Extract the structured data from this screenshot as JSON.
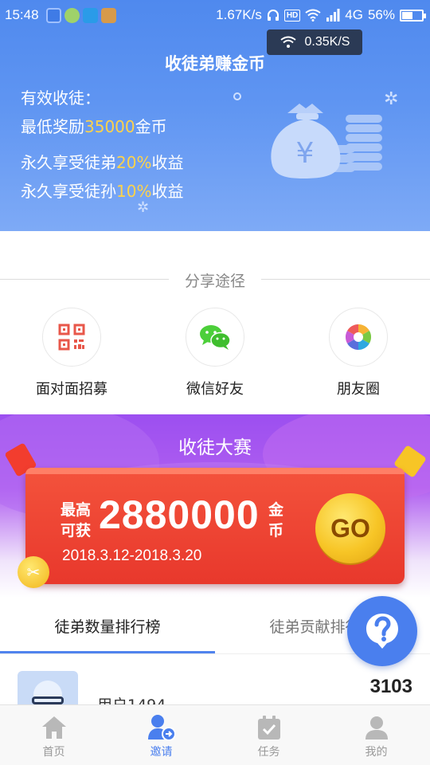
{
  "status_bar": {
    "time": "15:48",
    "network_speed": "1.67K/s",
    "hd_badge": "HD",
    "signal_type": "4G",
    "battery_percent": "56%",
    "battery_level": 0.56
  },
  "speed_popup": {
    "text": "0.35K/S"
  },
  "hero": {
    "title": "收徒弟赚金币",
    "line1": "有效收徒：",
    "line2_prefix": "最低奖励",
    "line2_highlight": "35000",
    "line2_suffix": "金币",
    "line3_prefix": "永久享受徒弟",
    "line3_highlight": "20%",
    "line3_suffix": "收益",
    "line4_prefix": "永久享受徒孙",
    "line4_highlight": "10%",
    "line4_suffix": "收益",
    "money_bag_symbol": "¥"
  },
  "share": {
    "header": "分享途径",
    "items": [
      {
        "label": "面对面招募",
        "icon": "qr-code-icon"
      },
      {
        "label": "微信好友",
        "icon": "wechat-icon"
      },
      {
        "label": "朋友圈",
        "icon": "moments-icon"
      }
    ]
  },
  "contest": {
    "title": "收徒大赛",
    "small_line1": "最高",
    "small_line2": "可获",
    "amount": "2880000",
    "unit_line1": "金",
    "unit_line2": "币",
    "dates": "2018.3.12-2018.3.20",
    "go_label": "GO"
  },
  "rank_tabs": {
    "tab1": "徒弟数量排行榜",
    "tab2": "徒弟贡献排行榜"
  },
  "rank_list": [
    {
      "name": "用户1494",
      "count": "3103"
    }
  ],
  "bottom_nav": {
    "items": [
      {
        "label": "首页",
        "icon": "home-icon",
        "active": false
      },
      {
        "label": "邀请",
        "icon": "invite-icon",
        "active": true
      },
      {
        "label": "任务",
        "icon": "task-icon",
        "active": false
      },
      {
        "label": "我的",
        "icon": "profile-icon",
        "active": false
      }
    ]
  },
  "colors": {
    "brand_blue": "#4a7fee",
    "highlight_gold": "#ffd34a",
    "contest_red": "#e8382c",
    "contest_purple": "#9c4ff0"
  }
}
